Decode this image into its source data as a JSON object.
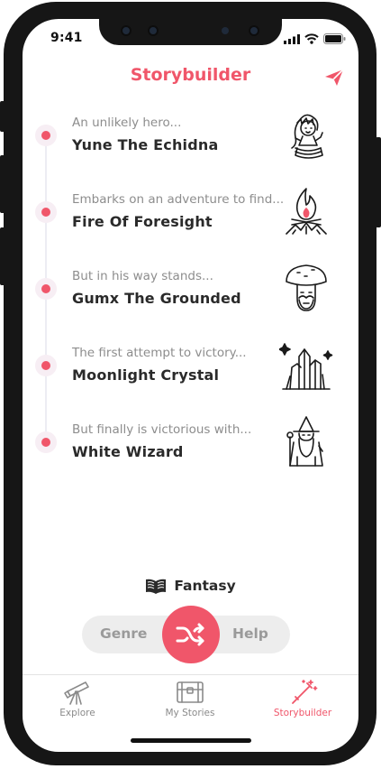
{
  "status_bar": {
    "time": "9:41"
  },
  "header": {
    "title": "Storybuilder",
    "send_icon": "paper-plane-icon"
  },
  "story": [
    {
      "prompt": "An unlikely hero...",
      "choice": "Yune The Echidna",
      "art": "echidna-girl-icon"
    },
    {
      "prompt": "Embarks on an adventure to find...",
      "choice": "Fire Of Foresight",
      "art": "campfire-icon"
    },
    {
      "prompt": "But in his way stands...",
      "choice": "Gumx The Grounded",
      "art": "mushroom-man-icon"
    },
    {
      "prompt": "The first attempt to victory...",
      "choice": "Moonlight Crystal",
      "art": "crystal-icon"
    },
    {
      "prompt": "But finally is victorious with...",
      "choice": "White Wizard",
      "art": "wizard-icon"
    }
  ],
  "genre": {
    "label": "Fantasy",
    "icon": "open-book-icon"
  },
  "controls": {
    "left_label": "Genre",
    "right_label": "Help",
    "center_icon": "shuffle-icon"
  },
  "tabs": [
    {
      "label": "Explore",
      "icon": "telescope-icon",
      "active": false
    },
    {
      "label": "My Stories",
      "icon": "treasure-chest-icon",
      "active": false
    },
    {
      "label": "Storybuilder",
      "icon": "magic-wand-icon",
      "active": true
    }
  ],
  "colors": {
    "accent": "#f0566a",
    "text": "#2a2a2a",
    "muted": "#8d8d8d",
    "pill": "#ededed"
  }
}
